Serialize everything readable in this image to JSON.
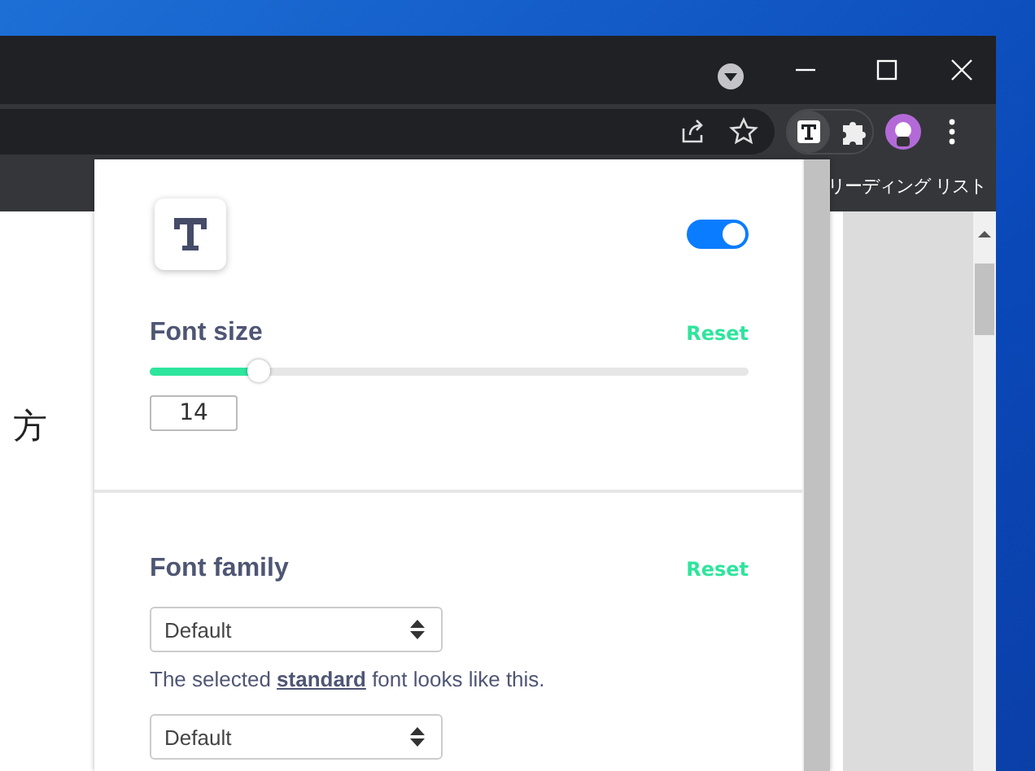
{
  "browser": {
    "reading_list": "リーディング リスト",
    "page_text": "方"
  },
  "extension": {
    "enabled": true,
    "sections": [
      {
        "kind": "slider",
        "title": "Font size",
        "reset": "Reset",
        "level": 0.17,
        "value": "14"
      },
      {
        "kind": "selects",
        "title": "Font family",
        "reset": "Reset",
        "selects": [
          {
            "value": "Default",
            "caption": "The selected **standard** font looks like this."
          },
          {
            "value": "Default"
          }
        ]
      }
    ]
  }
}
